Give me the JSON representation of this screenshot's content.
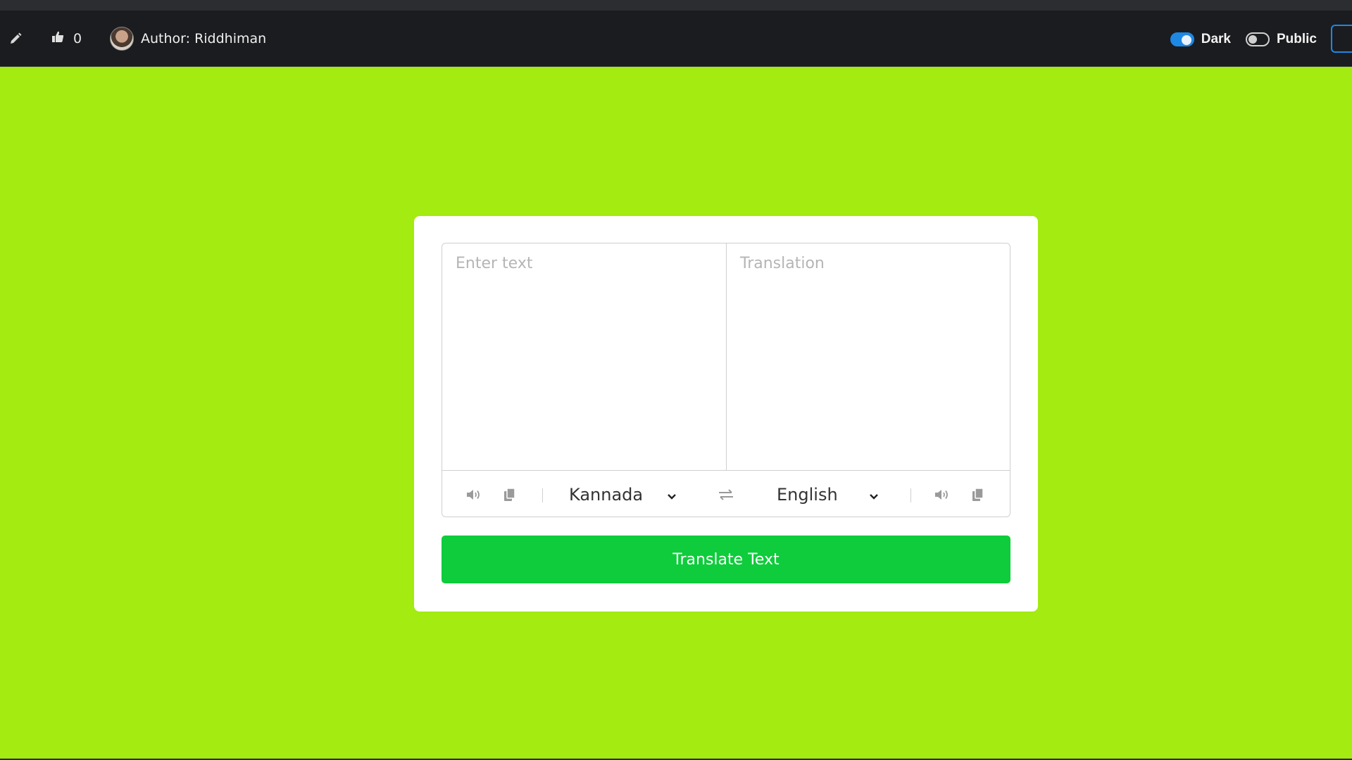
{
  "header": {
    "like_count": "0",
    "author": "Author: Riddhiman",
    "toggles": {
      "dark_label": "Dark",
      "dark_on": true,
      "public_label": "Public",
      "public_on": false
    },
    "icons": [
      "pencil-icon",
      "thumbs-up-icon",
      "avatar"
    ]
  },
  "translator": {
    "from_placeholder": "Enter text",
    "to_placeholder": "Translation",
    "from_language": "Kannada",
    "to_language": "English",
    "translate_button": "Translate Text",
    "icons": [
      "volume-icon",
      "copy-icon",
      "chevron-down-icon",
      "exchange-icon"
    ]
  },
  "colors": {
    "page_background": "#a3eb10",
    "header_background": "#1b1c1f",
    "translate_button": "#0ecc3b",
    "toggle_on": "#1e88e5"
  }
}
